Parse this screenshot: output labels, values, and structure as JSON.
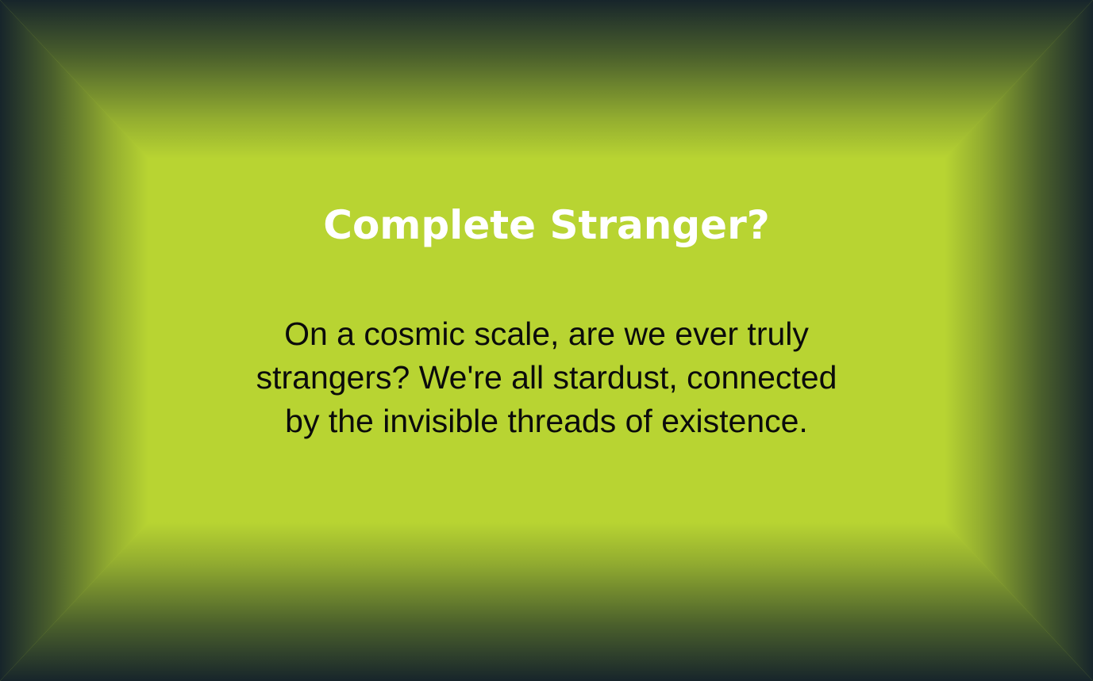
{
  "card": {
    "title": "Complete Stranger?",
    "body": "On a cosmic scale, are we ever truly\nstrangers? We're all stardust, connected\nby the invisible threads of existence."
  },
  "colors": {
    "accent": "#b8d432",
    "frame_dark": "#17252b",
    "title_text": "#ffffff",
    "body_text": "#0b0b0b"
  }
}
